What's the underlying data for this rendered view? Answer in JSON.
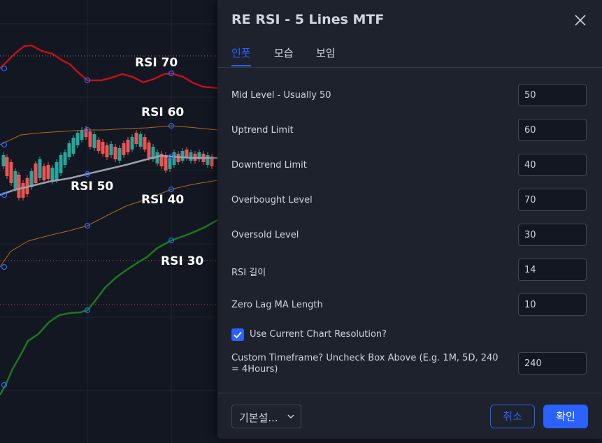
{
  "chart": {
    "labels": {
      "rsi70": "RSI 70",
      "rsi60": "RSI 60",
      "rsi50": "RSI 50",
      "rsi40": "RSI 40",
      "rsi30": "RSI 30"
    },
    "colors": {
      "background": "#131722",
      "grid": "#1f2330",
      "rsi70_line": "#c21018",
      "rsi30_line": "#1b7a1e",
      "band_lines": "#b36a1c",
      "mid_line": "#9aa0ad",
      "candle_up": "#26a69a",
      "candle_down": "#ef5350",
      "marker": "#2962ff"
    }
  },
  "dialog": {
    "title": "RE RSI - 5 Lines MTF",
    "close_icon": "close-icon",
    "tabs": [
      {
        "label": "인풋",
        "active": true
      },
      {
        "label": "모습",
        "active": false
      },
      {
        "label": "보임",
        "active": false
      }
    ],
    "inputs": [
      {
        "label": "Mid Level - Usually 50",
        "value": "50"
      },
      {
        "label": "Uptrend Limit",
        "value": "60"
      },
      {
        "label": "Downtrend Limit",
        "value": "40"
      },
      {
        "label": "Overbought Level",
        "value": "70"
      },
      {
        "label": "Oversold Level",
        "value": "30"
      },
      {
        "label": "RSI 길이",
        "value": "14"
      },
      {
        "label": "Zero Lag MA Length",
        "value": "10"
      }
    ],
    "checkbox": {
      "label": "Use Current Chart Resolution?",
      "checked": true
    },
    "custom_timeframe": {
      "label": "Custom Timeframe? Uncheck Box Above (E.g. 1M, 5D, 240 = 4Hours)",
      "value": "240"
    },
    "footer": {
      "defaults_label": "기본설...",
      "cancel_label": "취소",
      "ok_label": "확인"
    },
    "accent": "#2962ff"
  }
}
